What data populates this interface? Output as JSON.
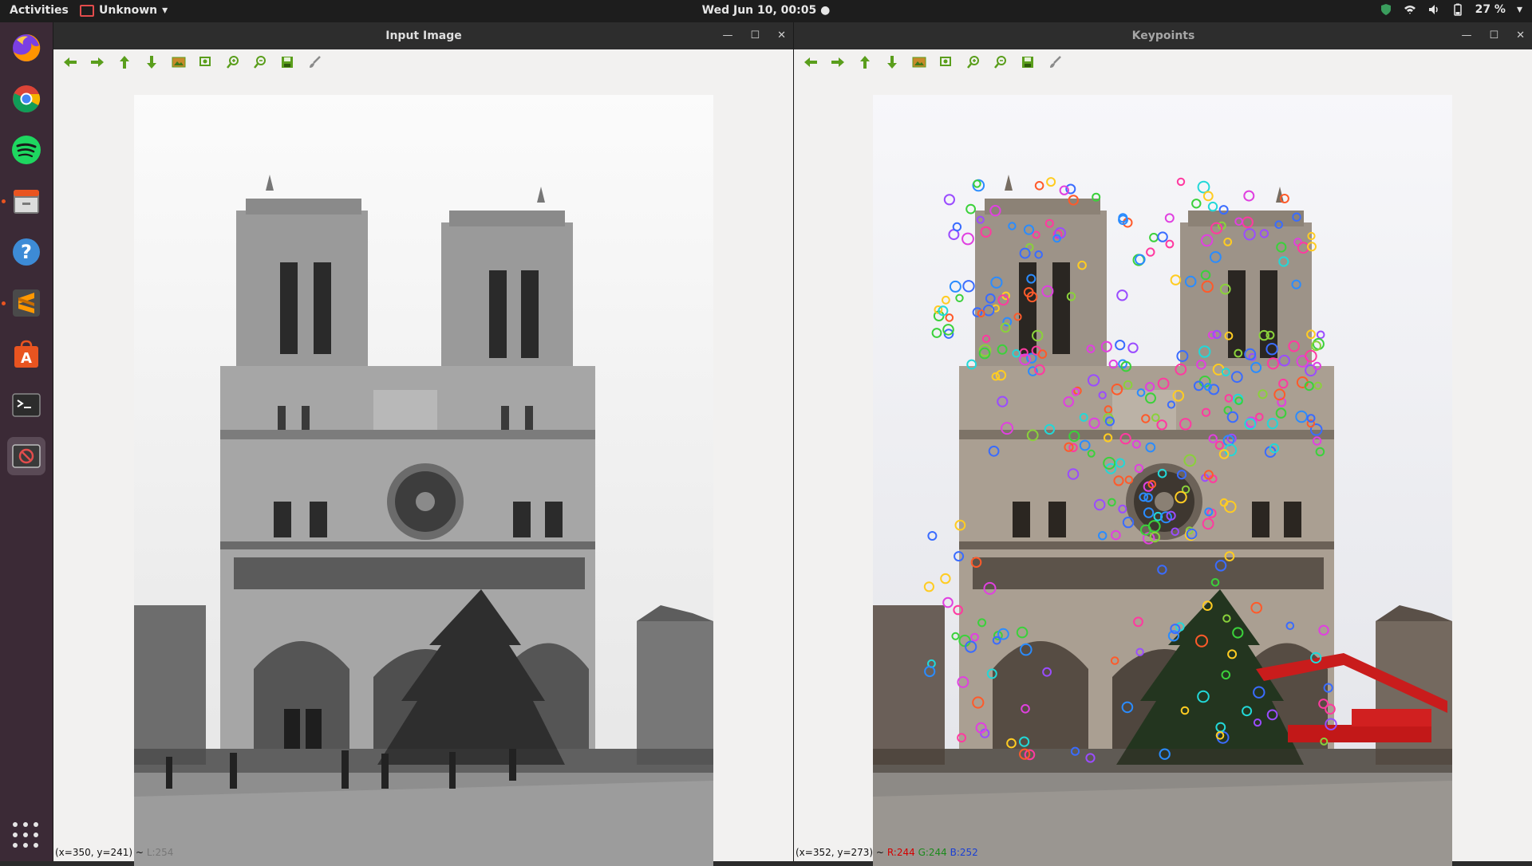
{
  "topbar": {
    "activities": "Activities",
    "app_menu": "Unknown",
    "clock": "Wed Jun 10, 00:05",
    "battery": "27 %"
  },
  "dock": {
    "items": [
      {
        "name": "firefox-icon"
      },
      {
        "name": "chrome-icon"
      },
      {
        "name": "spotify-icon"
      },
      {
        "name": "files-icon"
      },
      {
        "name": "help-icon"
      },
      {
        "name": "sublime-text-icon"
      },
      {
        "name": "software-center-icon"
      },
      {
        "name": "terminal-icon"
      },
      {
        "name": "unknown-app-icon"
      }
    ]
  },
  "left_window": {
    "title": "Input Image",
    "status_coords": "(x=350, y=241) ~",
    "status_value": "L:254"
  },
  "right_window": {
    "title": "Keypoints",
    "status_coords": "(x=352, y=273) ~",
    "status_r": "R:244",
    "status_g": "G:244",
    "status_b": "B:252"
  },
  "colors": {
    "accent": "#e95420",
    "toolbar_green": "#5a9e1c"
  }
}
